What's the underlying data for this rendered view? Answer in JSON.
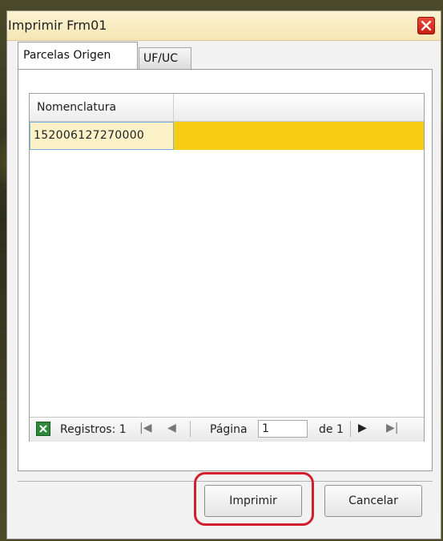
{
  "dialog": {
    "title": "Imprimir Frm01"
  },
  "tabs": [
    {
      "label": "Parcelas Origen",
      "active": true
    },
    {
      "label": "UF/UC",
      "active": false
    }
  ],
  "grid": {
    "columns": [
      "Nomenclatura"
    ],
    "rows": [
      {
        "nomenclatura": "152006127270000",
        "selected": true
      }
    ]
  },
  "pager": {
    "records_label": "Registros: 1",
    "page_label": "Página",
    "page_value": "1",
    "of_label": "de 1"
  },
  "buttons": {
    "print": "Imprimir",
    "cancel": "Cancelar"
  },
  "colors": {
    "selected_row": "#f8cd15",
    "title_bar": "#f5e6b4",
    "close_button": "#d42a1c",
    "highlight_ring": "#d21f2e"
  }
}
